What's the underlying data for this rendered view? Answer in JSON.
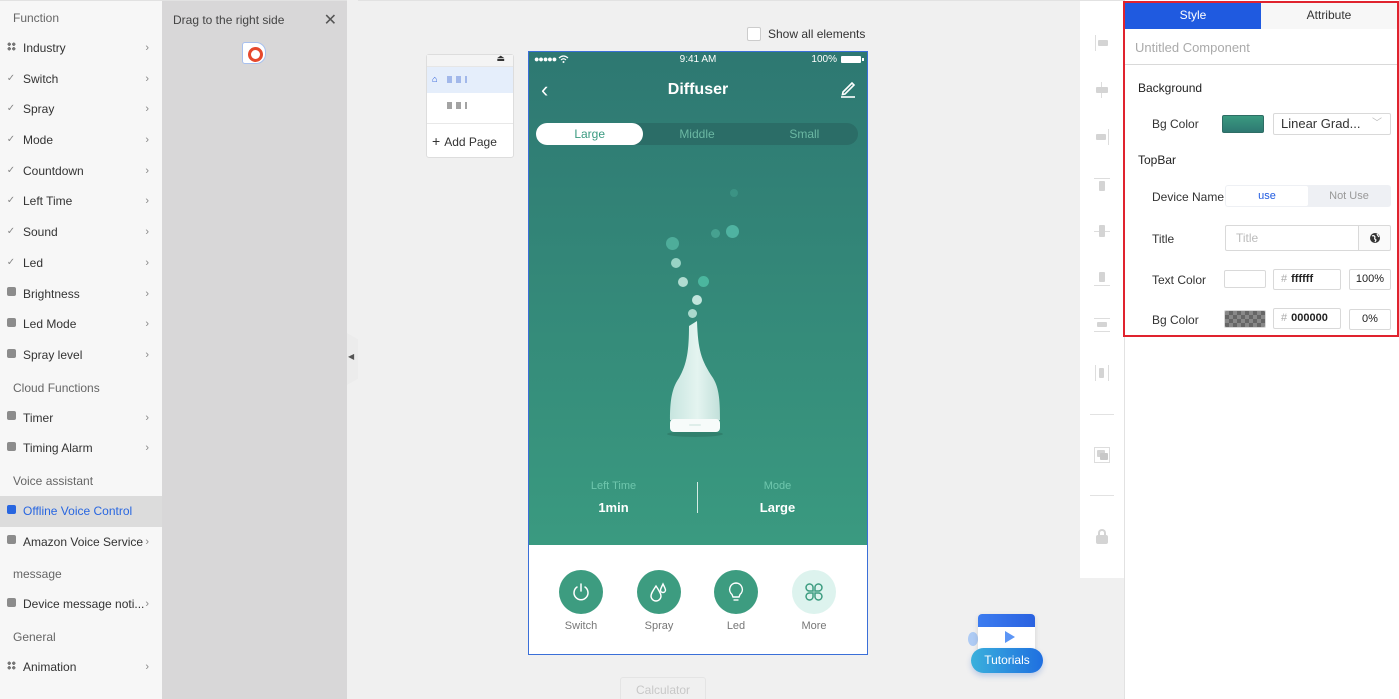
{
  "sidebar": {
    "sections": [
      {
        "title": "Function",
        "items": [
          {
            "label": "Industry",
            "icon": "grid-icon"
          },
          {
            "label": "Switch",
            "icon": "check-icon"
          },
          {
            "label": "Spray",
            "icon": "check-icon"
          },
          {
            "label": "Mode",
            "icon": "check-icon"
          },
          {
            "label": "Countdown",
            "icon": "check-icon"
          },
          {
            "label": "Left Time",
            "icon": "check-icon"
          },
          {
            "label": "Sound",
            "icon": "check-icon"
          },
          {
            "label": "Led",
            "icon": "check-icon"
          },
          {
            "label": "Brightness",
            "icon": "cube-icon"
          },
          {
            "label": "Led Mode",
            "icon": "cube-icon"
          },
          {
            "label": "Spray level",
            "icon": "cube-icon"
          }
        ]
      },
      {
        "title": "Cloud Functions",
        "items": [
          {
            "label": "Timer",
            "icon": "cube-icon"
          },
          {
            "label": "Timing Alarm",
            "icon": "cube-icon"
          }
        ]
      },
      {
        "title": "Voice assistant",
        "items": [
          {
            "label": "Offline Voice Control",
            "icon": "cube-icon",
            "active": true
          },
          {
            "label": "Amazon Voice Service",
            "icon": "cube-icon"
          }
        ]
      },
      {
        "title": "message",
        "items": [
          {
            "label": "Device message noti...",
            "icon": "cube-icon"
          }
        ]
      },
      {
        "title": "General",
        "items": [
          {
            "label": "Animation",
            "icon": "grid-icon"
          }
        ]
      }
    ]
  },
  "drag_panel": {
    "title": "Drag to the right side",
    "close_icon": "close-icon"
  },
  "canvas": {
    "show_all_label": "Show all elements",
    "show_all_checked": false,
    "pages": {
      "add_page_label": "Add Page"
    },
    "calculator_label": "Calculator",
    "tutorials_label": "Tutorials"
  },
  "phone": {
    "status": {
      "signal": "●●●●●",
      "time": "9:41 AM",
      "battery": "100%"
    },
    "title": "Diffuser",
    "segments": [
      {
        "label": "Large",
        "active": true
      },
      {
        "label": "Middle",
        "active": false
      },
      {
        "label": "Small",
        "active": false
      }
    ],
    "stats": [
      {
        "label": "Left Time",
        "value": "1min"
      },
      {
        "label": "Mode",
        "value": "Large"
      }
    ],
    "actions": [
      {
        "label": "Switch",
        "icon": "power-icon"
      },
      {
        "label": "Spray",
        "icon": "droplets-icon"
      },
      {
        "label": "Led",
        "icon": "bulb-icon"
      },
      {
        "label": "More",
        "icon": "clover-icon"
      }
    ],
    "colors": {
      "gradient_top": "#2e7872",
      "gradient_bottom": "#3a9a80",
      "accent": "#3d9c80"
    }
  },
  "right_panel": {
    "tabs": [
      {
        "label": "Style",
        "active": true
      },
      {
        "label": "Attribute",
        "active": false
      }
    ],
    "component_name_placeholder": "Untitled Component",
    "background": {
      "section_title": "Background",
      "bg_color_label": "Bg Color",
      "bg_color_swatch": "#3a9a80",
      "fill_type": "Linear Grad..."
    },
    "topbar": {
      "section_title": "TopBar",
      "device_name_label": "Device Name",
      "device_name_options": [
        "use",
        "Not Use"
      ],
      "device_name_selected": "use",
      "title_label": "Title",
      "title_placeholder": "Title",
      "title_value": "",
      "text_color_label": "Text Color",
      "text_color_hex": "ffffff",
      "text_color_opacity": "100%",
      "bg_color_label": "Bg Color",
      "bg_color_hex": "000000",
      "bg_color_opacity": "0%"
    },
    "accent_color": "#1f5ae0",
    "highlight_color": "#e0232e"
  }
}
